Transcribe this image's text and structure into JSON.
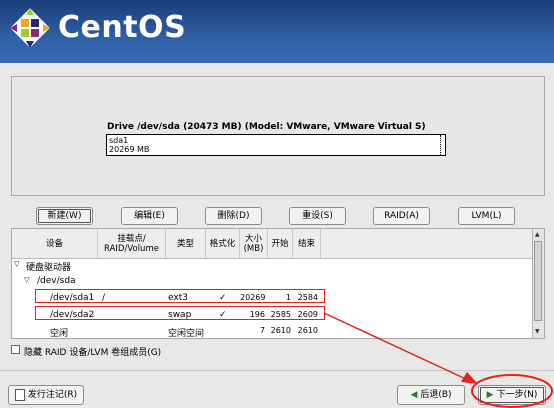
{
  "brand": {
    "name": "CentOS"
  },
  "drive": {
    "title": "Drive /dev/sda (20473 MB) (Model: VMware, VMware Virtual S)",
    "partition_name": "sda1",
    "partition_size": "20269 MB"
  },
  "actions": {
    "new": "新建(W)",
    "edit": "编辑(E)",
    "delete": "删除(D)",
    "reset": "重设(S)",
    "raid": "RAID(A)",
    "lvm": "LVM(L)"
  },
  "table": {
    "headers": [
      "设备",
      "挂载点/\nRAID/Volume",
      "类型",
      "格式化",
      "大小\n(MB)",
      "开始",
      "结束"
    ],
    "group": "硬盘驱动器",
    "disk": "/dev/sda",
    "rows": [
      {
        "device": "/dev/sda1",
        "mount": "/",
        "type": "ext3",
        "format": "✓",
        "size": "20269",
        "start": "1",
        "end": "2584"
      },
      {
        "device": "/dev/sda2",
        "mount": "",
        "type": "swap",
        "format": "✓",
        "size": "196",
        "start": "2585",
        "end": "2609"
      },
      {
        "device": "空闲",
        "mount": "",
        "type": "空闲空间",
        "format": "",
        "size": "7",
        "start": "2610",
        "end": "2610"
      }
    ]
  },
  "hide_raid_label": "隐藏 RAID 设备/LVM 卷组成员(G)",
  "footer": {
    "release_notes": "发行注记(R)",
    "back": "后退(B)",
    "next": "下一步(N)"
  },
  "colors": {
    "header": "#2f5fa5",
    "annotation": "#e0251f"
  }
}
